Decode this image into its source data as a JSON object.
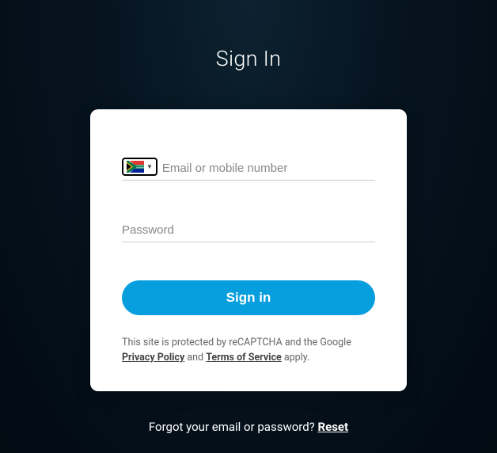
{
  "title": "Sign In",
  "form": {
    "email_placeholder": "Email or mobile number",
    "password_placeholder": "Password",
    "country_flag": "south-africa",
    "submit_label": "Sign in"
  },
  "recaptcha": {
    "prefix": "This site is protected by reCAPTCHA and the Google ",
    "privacy_label": "Privacy Policy",
    "and": " and ",
    "terms_label": "Terms of Service",
    "suffix": " apply."
  },
  "forgot": {
    "text": "Forgot your email or password? ",
    "link_label": "Reset"
  }
}
